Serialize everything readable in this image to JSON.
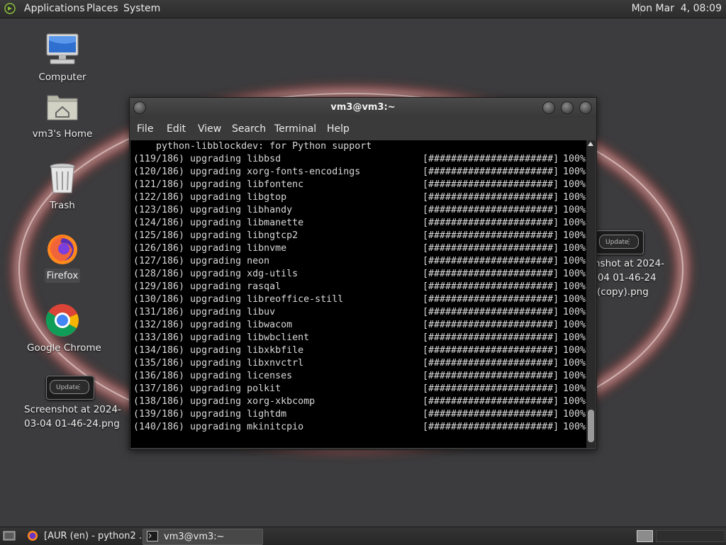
{
  "top_panel": {
    "menus": [
      "Applications",
      "Places",
      "System"
    ],
    "clock": "Mon Mar  4, 08:09"
  },
  "desktop": {
    "icons": [
      {
        "label": "Computer",
        "icon": "computer-icon"
      },
      {
        "label": "vm3's Home",
        "icon": "home-folder-icon"
      },
      {
        "label": "Trash",
        "icon": "trash-icon"
      },
      {
        "label": "Firefox",
        "icon": "firefox-icon"
      },
      {
        "label": "Google Chrome",
        "icon": "chrome-icon"
      }
    ],
    "screenshot_left": {
      "line1": "Screenshot at 2024-",
      "line2": "03-04 01-46-24.png",
      "thumb_label": "Update"
    },
    "screenshot_right": {
      "line1": "nshot at 2024-",
      "line2": "-04 01-46-24",
      "line3": "(copy).png",
      "thumb_label": "Update"
    }
  },
  "terminal": {
    "title": "vm3@vm3:~",
    "menu": [
      "File",
      "Edit",
      "View",
      "Search",
      "Terminal",
      "Help"
    ],
    "header_line": "    python-libblockdev: for Python support",
    "lines": [
      {
        "n": "(119/186)",
        "pkg": "libbsd"
      },
      {
        "n": "(120/186)",
        "pkg": "xorg-fonts-encodings"
      },
      {
        "n": "(121/186)",
        "pkg": "libfontenc"
      },
      {
        "n": "(122/186)",
        "pkg": "libgtop"
      },
      {
        "n": "(123/186)",
        "pkg": "libhandy"
      },
      {
        "n": "(124/186)",
        "pkg": "libmanette"
      },
      {
        "n": "(125/186)",
        "pkg": "libngtcp2"
      },
      {
        "n": "(126/186)",
        "pkg": "libnvme"
      },
      {
        "n": "(127/186)",
        "pkg": "neon"
      },
      {
        "n": "(128/186)",
        "pkg": "xdg-utils"
      },
      {
        "n": "(129/186)",
        "pkg": "rasqal"
      },
      {
        "n": "(130/186)",
        "pkg": "libreoffice-still"
      },
      {
        "n": "(131/186)",
        "pkg": "libuv"
      },
      {
        "n": "(132/186)",
        "pkg": "libwacom"
      },
      {
        "n": "(133/186)",
        "pkg": "libwbclient"
      },
      {
        "n": "(134/186)",
        "pkg": "libxkbfile"
      },
      {
        "n": "(135/186)",
        "pkg": "libxnvctrl"
      },
      {
        "n": "(136/186)",
        "pkg": "licenses"
      },
      {
        "n": "(137/186)",
        "pkg": "polkit"
      },
      {
        "n": "(138/186)",
        "pkg": "xorg-xkbcomp"
      },
      {
        "n": "(139/186)",
        "pkg": "lightdm"
      },
      {
        "n": "(140/186)",
        "pkg": "mkinitcpio"
      }
    ],
    "verb": "upgrading",
    "bar": "[######################]",
    "percent": "100%"
  },
  "taskbar": {
    "tasks": [
      {
        "label": "[AUR (en) - python2 ...",
        "icon": "firefox-icon"
      },
      {
        "label": "vm3@vm3:~",
        "icon": "terminal-icon"
      }
    ]
  },
  "colors": {
    "desktop_bg": "#3c3b3d",
    "terminal_bg": "#000000",
    "terminal_text": "#d8d8d8",
    "ring": "#d9b3b0"
  }
}
